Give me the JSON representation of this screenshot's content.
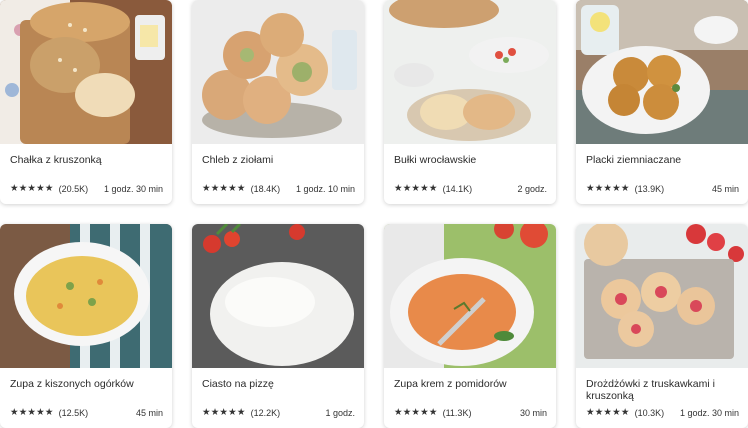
{
  "recipes": [
    {
      "title": "Chałka z kruszonką",
      "stars": "★★★★★",
      "count": "(20.5K)",
      "time": "1 godz. 30 min"
    },
    {
      "title": "Chleb z ziołami",
      "stars": "★★★★★",
      "count": "(18.4K)",
      "time": "1 godz. 10 min"
    },
    {
      "title": "Bułki wrocławskie",
      "stars": "★★★★★",
      "count": "(14.1K)",
      "time": "2 godz."
    },
    {
      "title": "Placki ziemniaczane",
      "stars": "★★★★★",
      "count": "(13.9K)",
      "time": "45 min"
    },
    {
      "title": "Zupa z kiszonych ogórków",
      "stars": "★★★★★",
      "count": "(12.5K)",
      "time": "45 min"
    },
    {
      "title": "Ciasto na pizzę",
      "stars": "★★★★★",
      "count": "(12.2K)",
      "time": "1 godz."
    },
    {
      "title": "Zupa krem z pomidorów",
      "stars": "★★★★★",
      "count": "(11.3K)",
      "time": "30 min"
    },
    {
      "title": "Drożdżówki z truskawkami i kruszonką",
      "stars": "★★★★★",
      "count": "(10.3K)",
      "time": "1 godz. 30 min"
    }
  ]
}
